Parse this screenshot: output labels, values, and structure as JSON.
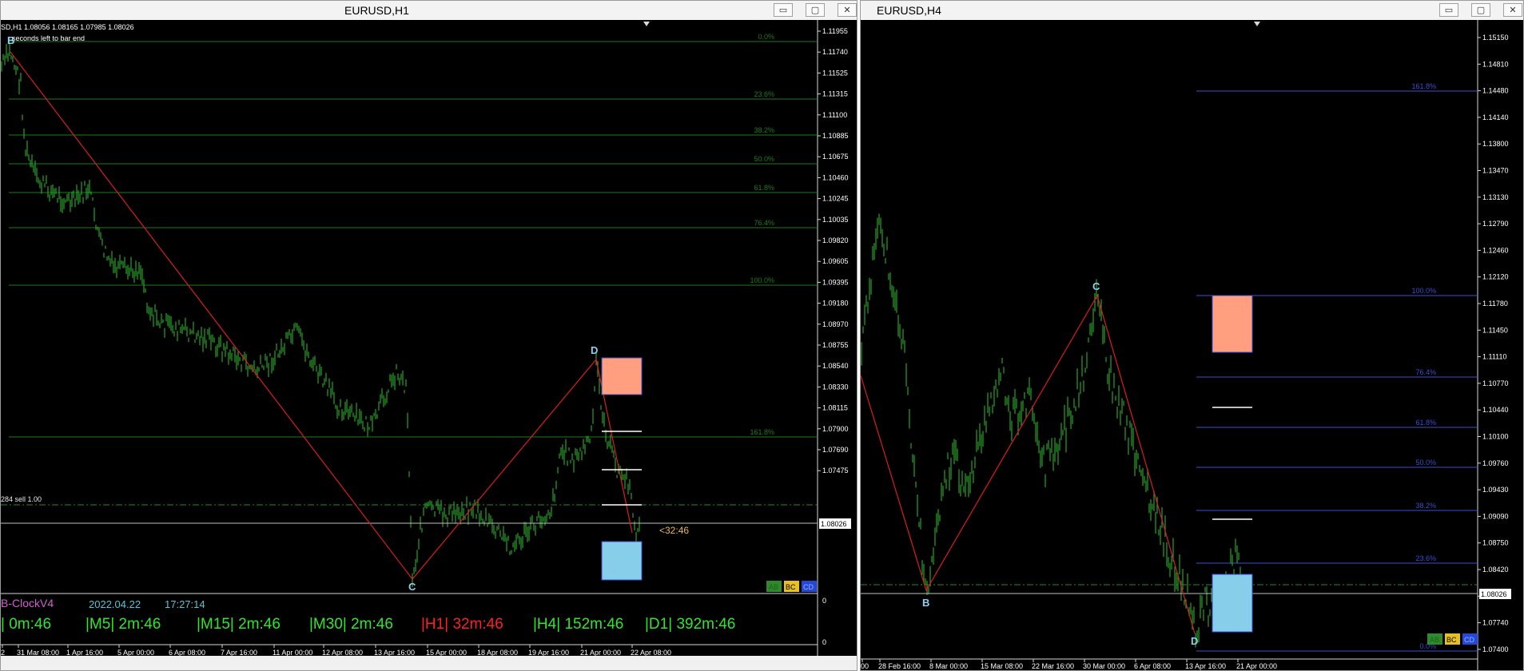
{
  "left_window": {
    "title": "EURUSD,H1",
    "buttons": [
      "▭",
      "▢",
      "✕"
    ],
    "info_line": "SD,H1  1.08056 1.08165 1.07985 1.08026",
    "info_line2": "seconds left to bar end",
    "trade_label": "284 sell 1.00",
    "countdown": "<32:46",
    "current_price": "1.08026",
    "fib_levels": [
      "0.0%",
      "23.6%",
      "38.2%",
      "50.0%",
      "61.8%",
      "76.4%",
      "100.0%",
      "161.8%"
    ],
    "points": [
      "B",
      "C",
      "D"
    ],
    "price_scale": [
      "1.11955",
      "1.11740",
      "1.11525",
      "1.11315",
      "1.11100",
      "1.10885",
      "1.10675",
      "1.10460",
      "1.10245",
      "1.10035",
      "1.09820",
      "1.09605",
      "1.09395",
      "1.09180",
      "1.08970",
      "1.08755",
      "1.08540",
      "1.08330",
      "1.08115",
      "1.07900",
      "1.07690",
      "1.07475"
    ],
    "time_axis": [
      "2",
      "31 Mar 08:00",
      "1 Apr 16:00",
      "5 Apr 00:00",
      "6 Apr 08:00",
      "7 Apr 16:00",
      "11 Apr 00:00",
      "12 Apr 08:00",
      "13 Apr 16:00",
      "15 Apr 00:00",
      "18 Apr 08:00",
      "19 Apr 16:00",
      "21 Apr 00:00",
      "22 Apr 08:00"
    ],
    "legend_buttons": [
      "AB",
      "BC",
      "CD"
    ],
    "clock": {
      "name": "B-ClockV4",
      "date": "2022.04.22",
      "time": "17:27:14",
      "timeframes": [
        {
          "label": "| 0m:46",
          "color": "#2ee62e"
        },
        {
          "label": "|M5| 2m:46",
          "color": "#2ee62e"
        },
        {
          "label": "|M15| 2m:46",
          "color": "#2ee62e"
        },
        {
          "label": "|M30| 2m:46",
          "color": "#2ee62e"
        },
        {
          "label": "|H1| 32m:46",
          "color": "#ff2020"
        },
        {
          "label": "|H4| 152m:46",
          "color": "#2ee62e"
        },
        {
          "label": "|D1| 392m:46",
          "color": "#2ee62e"
        }
      ],
      "scale_top": "0",
      "scale_bottom": "0"
    }
  },
  "right_window": {
    "title": "EURUSD,H4",
    "buttons": [
      "▭",
      "▢",
      "✕"
    ],
    "current_price": "1.08026",
    "fib_levels": [
      "161.8%",
      "100.0%",
      "76.4%",
      "61.8%",
      "50.0%",
      "38.2%",
      "23.6%",
      "0.0%"
    ],
    "points": [
      "B",
      "C",
      "D"
    ],
    "price_scale": [
      "1.15150",
      "1.14810",
      "1.14480",
      "1.14140",
      "1.13800",
      "1.13470",
      "1.13130",
      "1.12790",
      "1.12460",
      "1.12120",
      "1.11780",
      "1.11450",
      "1.11110",
      "1.10770",
      "1.10440",
      "1.10100",
      "1.09760",
      "1.09430",
      "1.09090",
      "1.08750",
      "1.08420",
      "1.08080",
      "1.07740",
      "1.07400"
    ],
    "time_axis": [
      "00",
      "28 Feb 16:00",
      "8 Mar 00:00",
      "15 Mar 08:00",
      "22 Mar 16:00",
      "30 Mar 00:00",
      "6 Apr 08:00",
      "13 Apr 16:00",
      "21 Apr 00:00"
    ],
    "legend_buttons": [
      "AB",
      "BC",
      "CD"
    ]
  },
  "colors": {
    "candle": "#27a327",
    "zigzag": "#d81e1e",
    "fib_left": "#1f7a1f",
    "fib_right": "#3c4ed0",
    "sell_box": "#ff9f7f",
    "buy_box": "#87ceeb",
    "point_label": "#8fd0f0"
  }
}
